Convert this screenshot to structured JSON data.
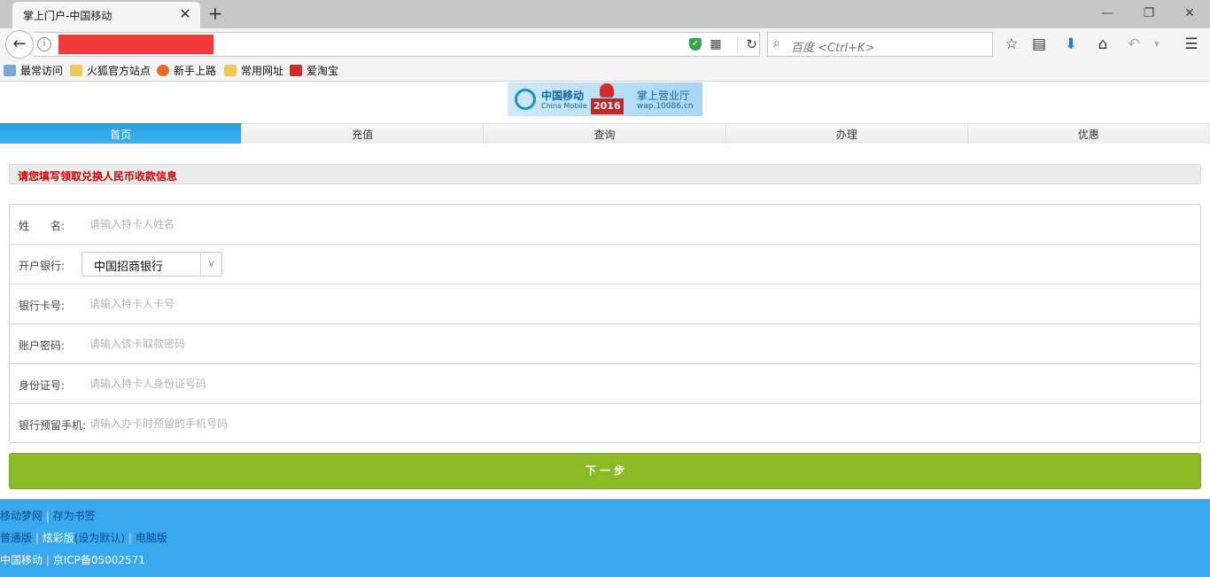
{
  "browser": {
    "tab_title": "掌上门户-中国移动",
    "tab_close": "✕",
    "new_tab": "+",
    "minimize": "—",
    "restore": "❐",
    "close": "✕",
    "search_placeholder": "百度 <Ctrl+K>",
    "icons": {
      "back": "back-arrow-icon",
      "info": "info-icon",
      "shield": "shield-icon",
      "qr": "qr-code-icon",
      "reload": "reload-icon",
      "search": "search-icon",
      "star": "bookmark-star-icon",
      "reader": "reading-list-icon",
      "download": "download-icon",
      "home": "home-icon",
      "undo": "undo-icon",
      "menu": "hamburger-menu-icon"
    },
    "bookmarks": [
      "最常访问",
      "火狐官方站点",
      "新手上路",
      "常用网址",
      "爱淘宝"
    ]
  },
  "logo": {
    "brand_cn": "中国移动",
    "brand_en": "China Mobile",
    "hall": "掌上营业厅",
    "url": "wap.10086.cn",
    "year": "2016"
  },
  "nav": [
    "首页",
    "充值",
    "查询",
    "办理",
    "优惠"
  ],
  "notice": "请您填写领取兑换人民币收款信息",
  "form": {
    "name_label": "姓　　名:",
    "name_placeholder": "请输入持卡人姓名",
    "bank_label": "开户银行:",
    "bank_value": "中国招商银行",
    "card_label": "银行卡号:",
    "card_placeholder": "请输入持卡人卡号",
    "password_label": "账户密码:",
    "password_placeholder": "请输入该卡取款密码",
    "id_label": "身份证号:",
    "id_placeholder": "请输入持卡人身份证号码",
    "phone_label": "银行预留手机:",
    "phone_placeholder": "请输入办卡时预留的手机号码"
  },
  "next_button": "下 一 步",
  "footer": {
    "line1": {
      "link1": "移动梦网",
      "sep": " | ",
      "link2": "存为书签"
    },
    "line2": {
      "v1": "普通版",
      "sep1": " | ",
      "v2": "炫彩版",
      "v3": "(设为默认)",
      "sep2": " | ",
      "v4": "电脑版"
    },
    "line3": {
      "brand": "中国移动",
      "sep": " | ",
      "icp": "京ICP备05002571"
    }
  },
  "colors": {
    "nav_active": "#2ba3e9",
    "notice_text": "#d40000",
    "button": "#8aba24",
    "footer_bg": "#38a9ee",
    "footer_link": "#0b4a86"
  }
}
